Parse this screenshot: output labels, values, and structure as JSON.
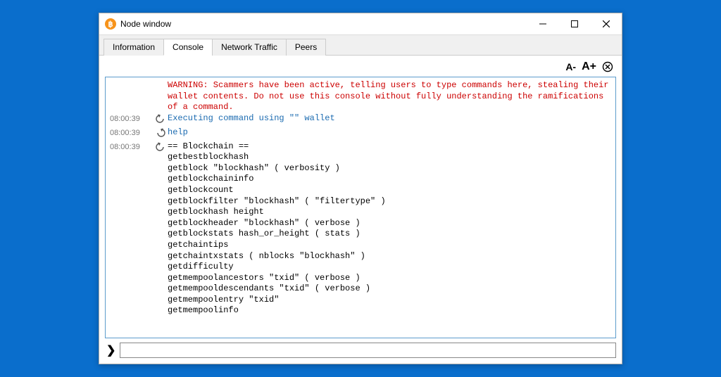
{
  "window": {
    "title": "Node window",
    "icon_letter": "฿"
  },
  "tabs": [
    {
      "label": "Information",
      "active": false
    },
    {
      "label": "Console",
      "active": true
    },
    {
      "label": "Network Traffic",
      "active": false
    },
    {
      "label": "Peers",
      "active": false
    }
  ],
  "toolbar": {
    "font_dec": "A-",
    "font_inc": "A+"
  },
  "console": {
    "warning": "WARNING: Scammers have been active, telling users to type commands here, stealing their wallet contents. Do not use this console without fully understanding the ramifications of a command.",
    "rows": [
      {
        "ts": "08:00:39",
        "icon": "reply",
        "cls": "cmd",
        "text": "Executing command using \"\" wallet"
      },
      {
        "ts": "08:00:39",
        "icon": "cmd",
        "cls": "cmd",
        "text": "help"
      },
      {
        "ts": "08:00:39",
        "icon": "reply",
        "cls": "body-text",
        "text": "== Blockchain ==\ngetbestblockhash\ngetblock \"blockhash\" ( verbosity )\ngetblockchaininfo\ngetblockcount\ngetblockfilter \"blockhash\" ( \"filtertype\" )\ngetblockhash height\ngetblockheader \"blockhash\" ( verbose )\ngetblockstats hash_or_height ( stats )\ngetchaintips\ngetchaintxstats ( nblocks \"blockhash\" )\ngetdifficulty\ngetmempoolancestors \"txid\" ( verbose )\ngetmempooldescendants \"txid\" ( verbose )\ngetmempoolentry \"txid\"\ngetmempoolinfo"
      }
    ]
  },
  "input": {
    "prompt": "❯",
    "value": ""
  }
}
